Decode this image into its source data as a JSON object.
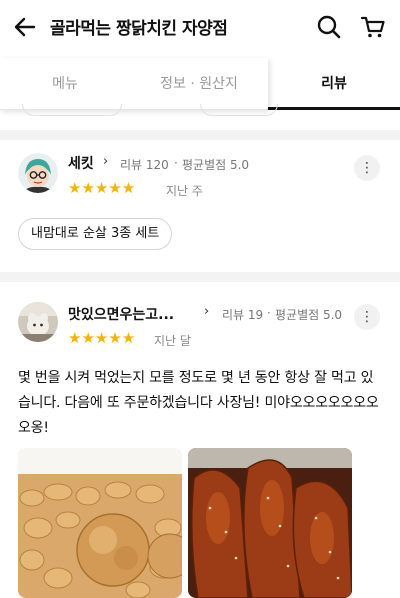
{
  "header": {
    "title": "골라먹는 짱닭치킨 자양점"
  },
  "tabs": [
    {
      "label": "메뉴"
    },
    {
      "label": "정보 · 원산지"
    },
    {
      "label": "리뷰"
    }
  ],
  "reviews": [
    {
      "name": "세킷",
      "review_count": "리뷰 120",
      "rating_label": "평균별점 5.0",
      "stars": "★★★★★",
      "rating": 5,
      "date": "지난 주",
      "ordered_item": "내맘대로 순살 3종 세트"
    },
    {
      "name": "맛있으면우는고...",
      "review_count": "리뷰 19",
      "rating_label": "평균별점 5.0",
      "stars": "★★★★★",
      "rating": 5,
      "date": "지난 달",
      "text": "몇 번을 시켜 먹었는지 모를 정도로 몇 년 동안 항상 잘 먹고 있습니다. 다음에 또 주문하겠습니다 사장님! 미야오오오오오오오오옹!"
    }
  ],
  "colors": {
    "star": "#f5b400",
    "tab_active": "#111111",
    "tab_inactive": "#9a9a9a"
  }
}
